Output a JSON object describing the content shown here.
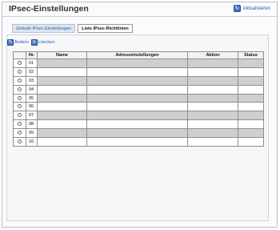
{
  "header": {
    "title": "IPsec-Einstellungen",
    "refresh_label": "Aktualisieren",
    "refresh_icon": "refresh-icon"
  },
  "tabs": [
    {
      "label": "Globale IPsec-Einstellungen",
      "active": false
    },
    {
      "label": "Liste IPsec-Richtlinien",
      "active": true
    }
  ],
  "toolbar": {
    "edit_label": "Ändern",
    "delete_label": "Löschen"
  },
  "table": {
    "columns": [
      "Nr.",
      "Name",
      "Adresseinstellungen",
      "Aktion",
      "Status"
    ],
    "rows": [
      {
        "nr": "01",
        "name": "",
        "address": "",
        "action": "",
        "status": ""
      },
      {
        "nr": "02",
        "name": "",
        "address": "",
        "action": "",
        "status": ""
      },
      {
        "nr": "03",
        "name": "",
        "address": "",
        "action": "",
        "status": ""
      },
      {
        "nr": "04",
        "name": "",
        "address": "",
        "action": "",
        "status": ""
      },
      {
        "nr": "05",
        "name": "",
        "address": "",
        "action": "",
        "status": ""
      },
      {
        "nr": "06",
        "name": "",
        "address": "",
        "action": "",
        "status": ""
      },
      {
        "nr": "07",
        "name": "",
        "address": "",
        "action": "",
        "status": ""
      },
      {
        "nr": "08",
        "name": "",
        "address": "",
        "action": "",
        "status": ""
      },
      {
        "nr": "09",
        "name": "",
        "address": "",
        "action": "",
        "status": ""
      },
      {
        "nr": "10",
        "name": "",
        "address": "",
        "action": "",
        "status": ""
      }
    ]
  },
  "colors": {
    "link": "#1b5fbf",
    "row_shade": "#cfcfcf",
    "tab_inactive_bg": "#dde5ef"
  }
}
